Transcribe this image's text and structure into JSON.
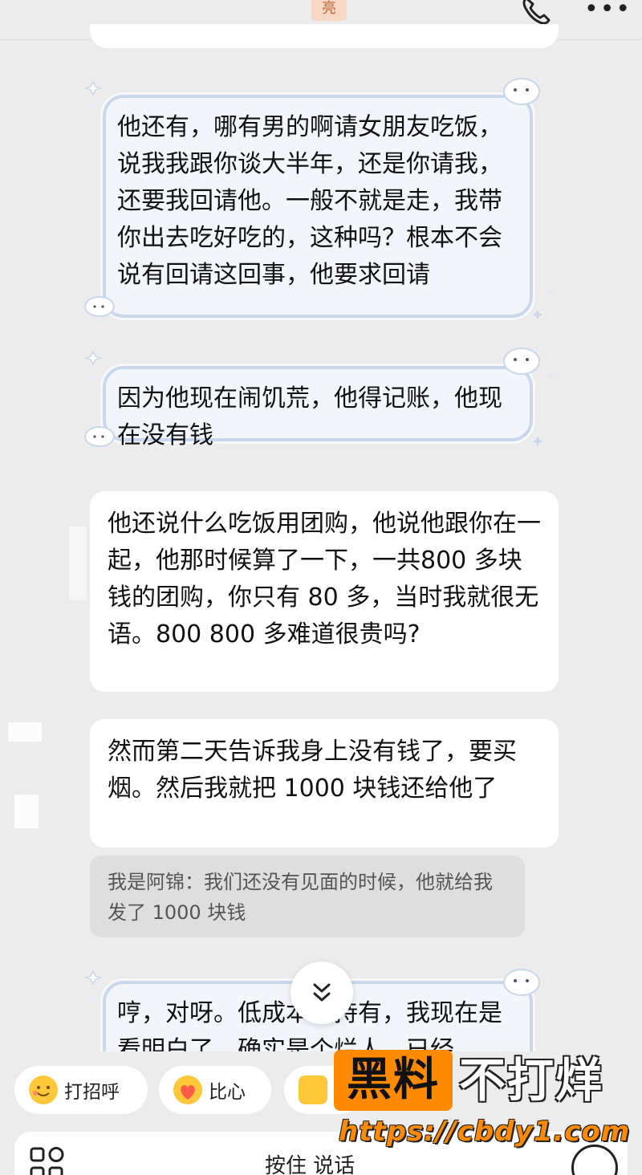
{
  "header": {
    "contact_name_fragment": "亮",
    "call_icon": "phone-icon",
    "more_icon": "more-icon",
    "more_glyph": "•••"
  },
  "messages": [
    {
      "style": "cute",
      "text": "他还有，哪有男的啊请女朋友吃饭，说我我跟你谈大半年，还是你请我，还要我回请他。一般不就是走，我带你出去吃好吃的，这种吗？根本不会说有回请这回事，他要求回请"
    },
    {
      "style": "cute",
      "text": "因为他现在闹饥荒，他得记账，他现在没有钱"
    },
    {
      "style": "plain",
      "text": "他还说什么吃饭用团购，他说他跟你在一起，他那时候算了一下，一共800 多块钱的团购，你只有 80 多，当时我就很无语。800 800 多难道很贵吗?"
    },
    {
      "style": "plain",
      "text": "然而第二天告诉我身上没有钱了，要买烟。然后我就把 1000 块钱还给他了"
    },
    {
      "style": "quote",
      "text": "我是阿锦：我们还没有见面的时候，他就给我发了 1000 块钱"
    },
    {
      "style": "cute",
      "text": "哼，对呀。低成本的持有，我现在是看明白了，确实是个烂人，已经"
    }
  ],
  "scroll_button": {
    "icon": "chevron-double-down-icon"
  },
  "quick_replies": [
    {
      "label": "打招呼",
      "icon": "smile-emoji-icon"
    },
    {
      "label": "比心",
      "icon": "heart-hand-emoji-icon"
    },
    {
      "label": "",
      "icon": "thumbs-up-emoji-icon"
    }
  ],
  "input": {
    "hold_to_talk": "按住 说话",
    "left_icon": "apps-grid-icon",
    "right_icon": "keyboard-icon"
  },
  "watermark": {
    "box_text": "黑料",
    "side_text": "不打烊",
    "url": "https://cbdy1.com"
  },
  "colors": {
    "background": "#ececec",
    "bubble_white": "#ffffff",
    "bubble_cute_border": "#c9d7ea",
    "watermark_orange": "#ff8a00"
  }
}
